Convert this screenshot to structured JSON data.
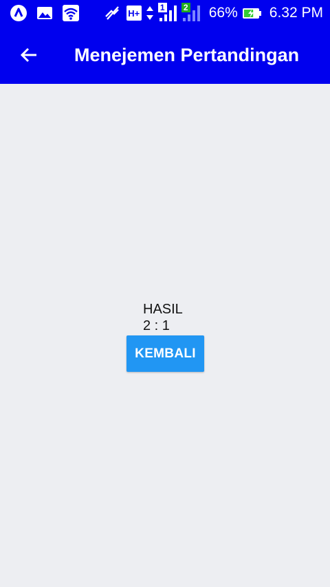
{
  "status_bar": {
    "icons": [
      "launcher-icon",
      "gallery-icon",
      "wifi-icon",
      "mute-icon",
      "hplus-network-icon",
      "data-arrows-icon",
      "signal-sim1-icon",
      "signal-sim2-icon"
    ],
    "sim1_label": "1",
    "sim2_label": "2",
    "network_label": "H+",
    "battery_percent": "66%",
    "battery_level": 0.66,
    "time": "6.32 PM"
  },
  "app_bar": {
    "title": "Menejemen Pertandingan",
    "back_icon": "arrow-left-icon",
    "color": "#0000ee"
  },
  "main": {
    "result_label": "HASIL",
    "result_score": "2 : 1",
    "back_button_label": "KEMBALI",
    "button_color": "#2196f3",
    "background": "#edeef2"
  }
}
